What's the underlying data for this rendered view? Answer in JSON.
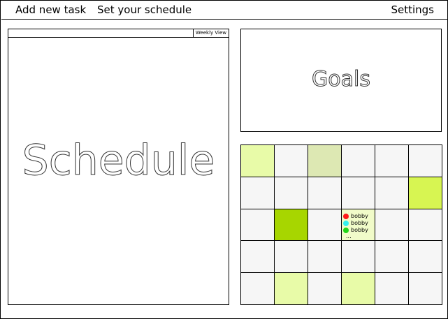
{
  "nav": {
    "add_task": "Add new task",
    "set_schedule": "Set your schedule",
    "settings": "Settings"
  },
  "schedule": {
    "view_button": "Weekly View",
    "title": "Schedule"
  },
  "goals": {
    "title": "Goals"
  },
  "calendar": {
    "cells": [
      {
        "color": "#e8fba8"
      },
      {
        "color": "#f6f6f6"
      },
      {
        "color": "#dde8b3"
      },
      {
        "color": "#f6f6f6"
      },
      {
        "color": "#f6f6f6"
      },
      {
        "color": "#f6f6f6"
      },
      {
        "color": "#f6f6f6"
      },
      {
        "color": "#f6f6f6"
      },
      {
        "color": "#f6f6f6"
      },
      {
        "color": "#f6f6f6"
      },
      {
        "color": "#f6f6f6"
      },
      {
        "color": "#d7f552"
      },
      {
        "color": "#f6f6f6"
      },
      {
        "color": "#a7d600"
      },
      {
        "color": "#f6f6f6"
      },
      {
        "color": "#f1fbc9",
        "events": [
          {
            "label": "bobby",
            "color": "#ff1a1a"
          },
          {
            "label": "bobby",
            "color": "#35f0f0"
          },
          {
            "label": "bobby",
            "color": "#22d619"
          }
        ],
        "more": "..."
      },
      {
        "color": "#f6f6f6"
      },
      {
        "color": "#f6f6f6"
      },
      {
        "color": "#f6f6f6"
      },
      {
        "color": "#f6f6f6"
      },
      {
        "color": "#f6f6f6"
      },
      {
        "color": "#f6f6f6"
      },
      {
        "color": "#f6f6f6"
      },
      {
        "color": "#f6f6f6"
      },
      {
        "color": "#f6f6f6"
      },
      {
        "color": "#e8fba8"
      },
      {
        "color": "#f6f6f6"
      },
      {
        "color": "#e8fba8"
      },
      {
        "color": "#f6f6f6"
      },
      {
        "color": "#f6f6f6"
      }
    ]
  }
}
